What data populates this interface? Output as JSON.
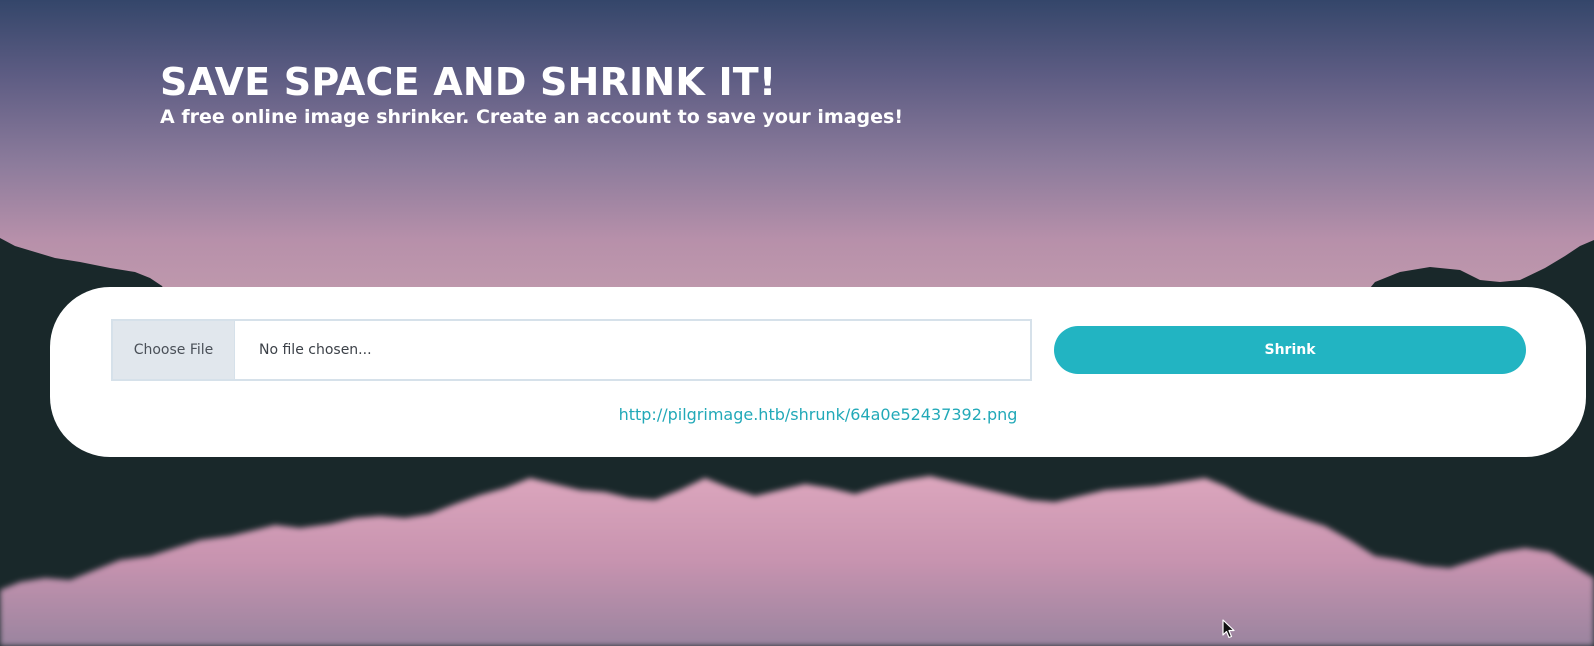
{
  "hero": {
    "title": "SAVE SPACE AND SHRINK IT!",
    "subtitle": "A free online image shrinker. Create an account to save your images!"
  },
  "upload": {
    "choose_label": "Choose File",
    "file_placeholder": "No file chosen...",
    "submit_label": "Shrink"
  },
  "result": {
    "link_text": "http://pilgrimage.htb/shrunk/64a0e52437392.png"
  },
  "colors": {
    "accent": "#22b4c2",
    "link": "#22a9b8",
    "mountain_dark": "#19282a",
    "sky_top": "#34466a",
    "sky_bottom": "#c09aad"
  },
  "icons": {
    "cursor": "mouse-pointer-icon"
  }
}
